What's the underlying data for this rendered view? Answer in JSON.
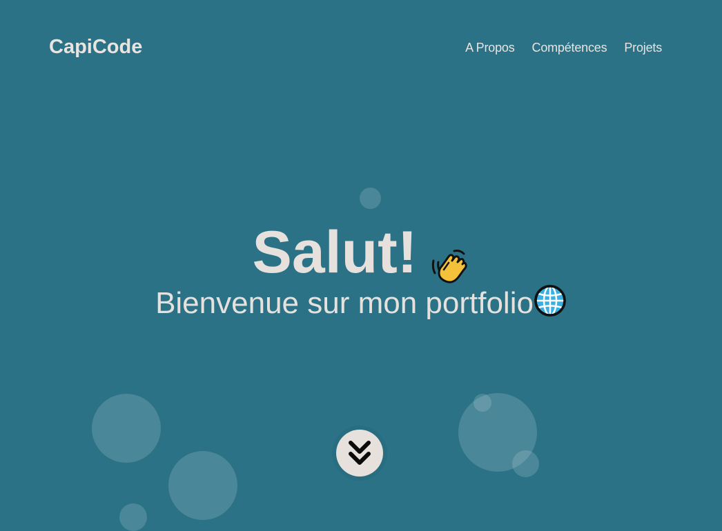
{
  "header": {
    "logo": "CapiCode",
    "nav": [
      {
        "label": "A Propos"
      },
      {
        "label": "Compétences"
      },
      {
        "label": "Projets"
      }
    ]
  },
  "hero": {
    "title": "Salut!",
    "title_icon": "waving-hand-icon",
    "subtitle": "Bienvenue sur mon portfolio",
    "subtitle_icon": "globe-icon",
    "scroll_icon": "double-chevron-down-icon"
  },
  "colors": {
    "background": "#2b7286",
    "text": "#e6e1dd",
    "button": "#e6e1dd",
    "bubble": "rgba(255,255,255,0.15)"
  }
}
